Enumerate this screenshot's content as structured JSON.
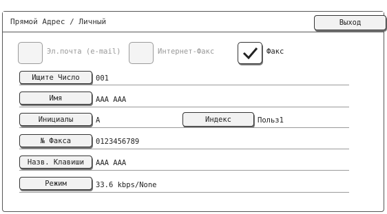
{
  "header": {
    "title": "Прямой Адрес / Личный",
    "exit_label": "Выход"
  },
  "address_types": [
    {
      "label": "Эл.почта (e-mail)",
      "checked": false
    },
    {
      "label": "Интернет-Факс",
      "checked": false
    },
    {
      "label": "Факс",
      "checked": true
    }
  ],
  "fields": {
    "search_number": {
      "button": "Ищите Число",
      "value": "001"
    },
    "name": {
      "button": "Имя",
      "value": "AAA AAA"
    },
    "initials": {
      "button": "Инициалы",
      "value": "A"
    },
    "index": {
      "button": "Индекс",
      "value": "Польз1"
    },
    "fax_number": {
      "button": "№ Факса",
      "value": "0123456789"
    },
    "key_name": {
      "button": "Назв. Клавиши",
      "value": "AAA AAA"
    },
    "mode": {
      "button": "Режим",
      "value": "33.6 kbps/None"
    }
  },
  "colors": {
    "border": "#333333",
    "button_face": "#f2f2f2",
    "disabled_text": "#999999"
  }
}
